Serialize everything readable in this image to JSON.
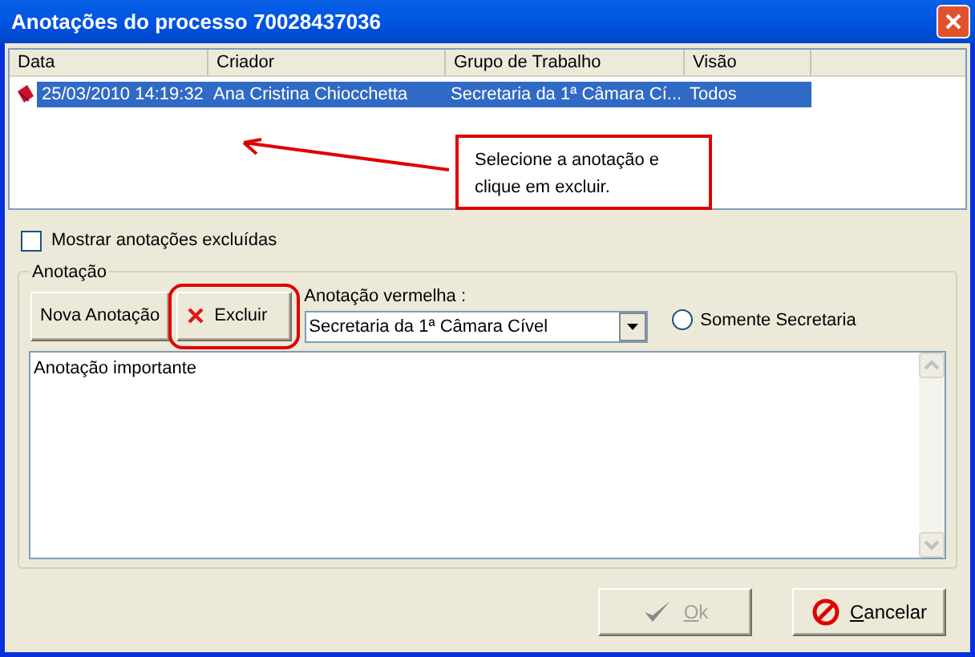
{
  "window": {
    "title": "Anotações do processo 70028437036"
  },
  "list": {
    "columns": [
      "Data",
      "Criador",
      "Grupo de Trabalho",
      "Visão"
    ],
    "rows": [
      {
        "cells": [
          "25/03/2010 14:19:32",
          "Ana Cristina Chiocchetta",
          "Secretaria da 1ª Câmara Cí...",
          "Todos"
        ],
        "selected": true
      }
    ]
  },
  "callout": {
    "text": "Selecione a anotação e clique em excluir."
  },
  "show_deleted": {
    "label": "Mostrar anotações excluídas",
    "checked": false
  },
  "group": {
    "title": "Anotação",
    "buttons": [
      {
        "label": "Nova Anotação",
        "highlighted": false,
        "kind": "plain"
      },
      {
        "label": "Excluir",
        "highlighted": true,
        "kind": "delete"
      }
    ],
    "red_label": "Anotação vermelha :",
    "combo_value": "Secretaria da 1ª Câmara Cível",
    "radio": {
      "label": "Somente Secretaria",
      "selected": false
    },
    "text": "Anotação importante"
  },
  "footer_buttons": [
    {
      "label": "Ok",
      "disabled": true,
      "kind": "ok"
    },
    {
      "label": "Cancelar",
      "disabled": false,
      "kind": "cancel"
    }
  ]
}
